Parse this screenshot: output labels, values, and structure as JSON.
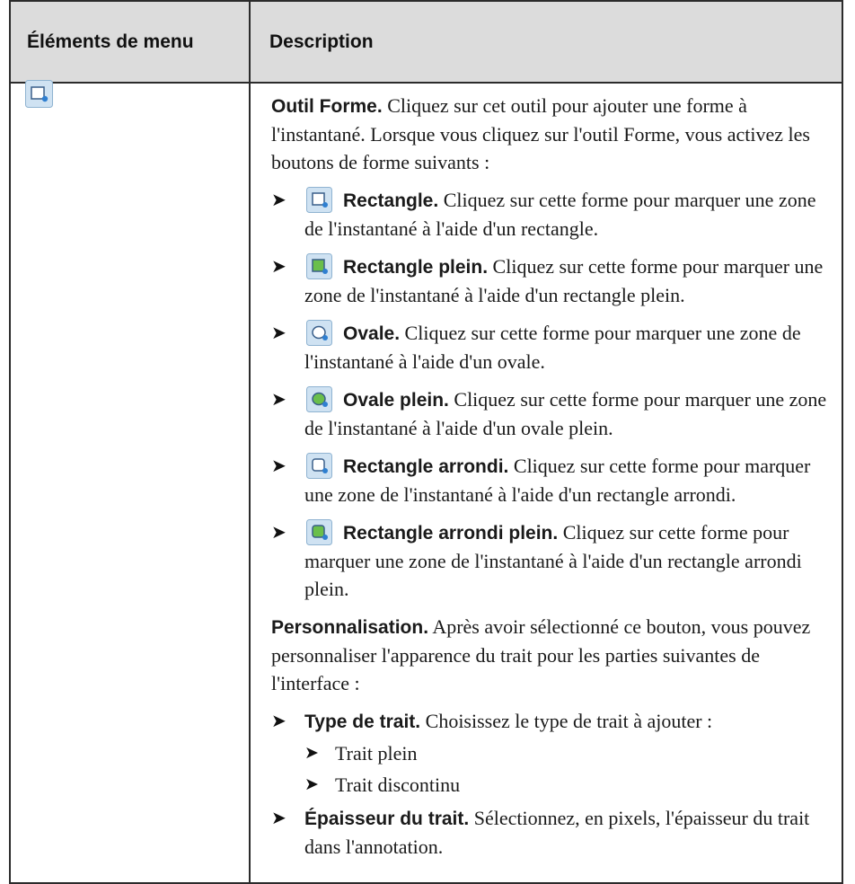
{
  "table": {
    "header": {
      "col1": "Éléments de menu",
      "col2": "Description"
    },
    "row": {
      "icon": "shape-tool-icon",
      "intro": {
        "title": "Outil Forme.",
        "text": " Cliquez sur cet outil pour ajouter une forme à l'instantané. Lorsque vous cliquez sur l'outil Forme, vous activez les boutons de forme suivants :"
      },
      "shapes": [
        {
          "icon": "rectangle-icon",
          "title": "Rectangle.",
          "text": " Cliquez sur cette forme pour marquer une zone de l'instantané à l'aide d'un rectangle."
        },
        {
          "icon": "filled-rectangle-icon",
          "title": "Rectangle plein.",
          "text": " Cliquez sur cette forme pour marquer une zone de l'instantané à l'aide d'un rectangle plein."
        },
        {
          "icon": "oval-icon",
          "title": "Ovale.",
          "text": " Cliquez sur cette forme pour marquer une zone de l'instantané à l'aide d'un ovale."
        },
        {
          "icon": "filled-oval-icon",
          "title": "Ovale plein.",
          "text": " Cliquez sur cette forme pour marquer une zone de l'instantané à l'aide d'un ovale plein."
        },
        {
          "icon": "rounded-rectangle-icon",
          "title": "Rectangle arrondi.",
          "text": " Cliquez sur cette forme pour marquer une zone de l'instantané à l'aide d'un rectangle arrondi."
        },
        {
          "icon": "filled-rounded-rectangle-icon",
          "title": "Rectangle arrondi plein.",
          "text": " Cliquez sur cette forme pour marquer une zone de l'instantané à l'aide d'un rectangle arrondi plein."
        }
      ],
      "custom": {
        "title": "Personnalisation.",
        "text": " Après avoir sélectionné ce bouton, vous pouvez personnaliser l'apparence du trait pour les parties suivantes de l'interface :"
      },
      "line_type": {
        "title": "Type de trait.",
        "text": " Choisissez le type de trait à ajouter :",
        "options": [
          "Trait plein",
          "Trait discontinu"
        ]
      },
      "line_width": {
        "title": "Épaisseur du trait.",
        "text": " Sélectionnez, en pixels, l'épaisseur du trait dans l'annotation."
      }
    }
  }
}
